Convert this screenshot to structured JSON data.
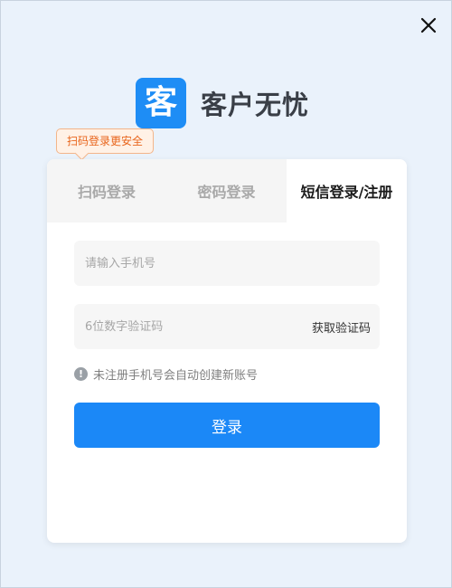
{
  "logo": {
    "mark": "客",
    "text": "客户无忧"
  },
  "qr_tip": "扫码登录更安全",
  "tabs": [
    {
      "label": "扫码登录",
      "active": false
    },
    {
      "label": "密码登录",
      "active": false
    },
    {
      "label": "短信登录/注册",
      "active": true
    }
  ],
  "form": {
    "phone": {
      "value": "",
      "placeholder": "请输入手机号"
    },
    "code": {
      "value": "",
      "placeholder": "6位数字验证码"
    },
    "get_code_label": "获取验证码",
    "notice_icon": "!",
    "notice": "未注册手机号会自动创建新账号",
    "submit_label": "登录"
  },
  "colors": {
    "background": "#eaf2fb",
    "brand": "#1b88f7",
    "tip_text": "#e8641b",
    "tip_bg": "#fff1e6"
  },
  "icons": {
    "close": "close-icon",
    "info": "info-icon"
  }
}
